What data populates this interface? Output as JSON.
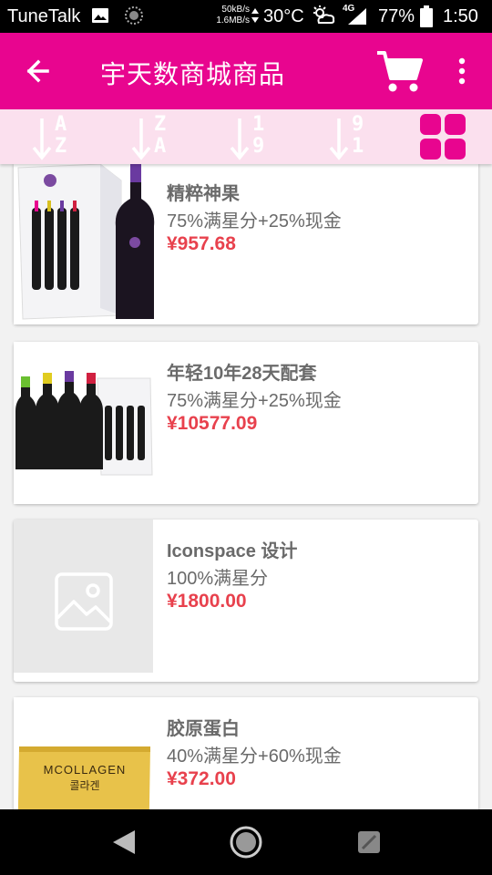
{
  "status_bar": {
    "carrier": "TuneTalk",
    "speed_up": "50kB/s",
    "speed_down": "1.6MB/s",
    "temperature": "30°C",
    "network": "4G",
    "battery": "77%",
    "time": "1:50"
  },
  "app_bar": {
    "title": "宇天数商城商品",
    "back_icon": "arrow-left-icon",
    "cart_icon": "shopping-cart-icon",
    "more_icon": "more-vertical-icon"
  },
  "sort_bar": {
    "options": [
      {
        "top": "A",
        "bottom": "Z"
      },
      {
        "top": "Z",
        "bottom": "A"
      },
      {
        "top": "1",
        "bottom": "9"
      },
      {
        "top": "9",
        "bottom": "1"
      }
    ],
    "view_icon": "grid-view-icon"
  },
  "products": [
    {
      "name": "精粹神果",
      "payment": "75%满星分+25%现金",
      "price": "¥957.68",
      "image": "wine-gift-box"
    },
    {
      "name": "年轻10年28天配套",
      "payment": "75%满星分+25%现金",
      "price": "¥10577.09",
      "image": "wine-bottle-set"
    },
    {
      "name": "Iconspace 设计",
      "payment": "100%满星分",
      "price": "¥1800.00",
      "image": "image-placeholder-icon"
    },
    {
      "name": "胶原蛋白",
      "payment": "40%满星分+60%现金",
      "price": "¥372.00",
      "image": "collagen-box",
      "box_text": "MCOLLAGEN",
      "box_sub": "콜라겐"
    }
  ],
  "colors": {
    "primary": "#e8058f",
    "sort_bar_bg": "#fbe0ee",
    "price": "#e8414d",
    "text_gray": "#6a6a6a"
  }
}
